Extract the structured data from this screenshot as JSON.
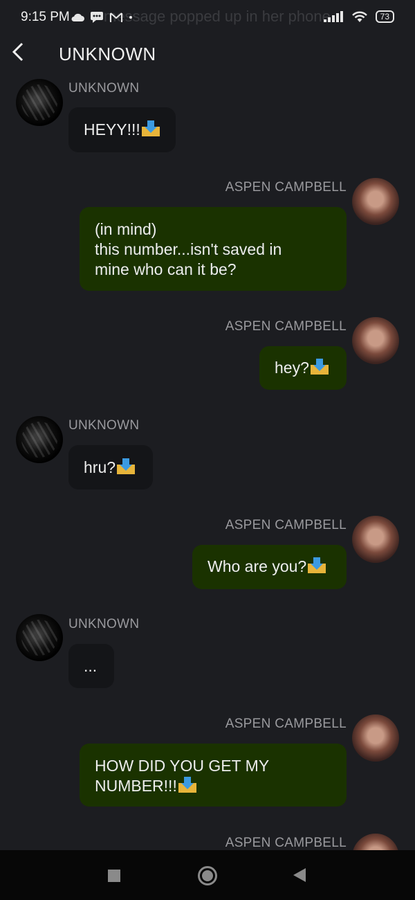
{
  "status_bar": {
    "time": "9:15 PM",
    "battery": "73",
    "ghost_notification": "message popped up in her phone"
  },
  "header": {
    "title": "UNKNOWN"
  },
  "messages": [
    {
      "sender": "UNKNOWN",
      "text": "HEYY!!!",
      "lines": []
    },
    {
      "sender": "ASPEN CAMPBELL",
      "lines": [
        "(in mind)",
        "this number...isn't saved in",
        "mine who can it be?"
      ]
    },
    {
      "sender": "ASPEN CAMPBELL",
      "text": "hey?"
    },
    {
      "sender": "UNKNOWN",
      "text": "hru?"
    },
    {
      "sender": "ASPEN CAMPBELL",
      "text": "Who are you?"
    },
    {
      "sender": "UNKNOWN",
      "text": "..."
    },
    {
      "sender": "ASPEN CAMPBELL",
      "lines": [
        "HOW DID YOU GET MY",
        "NUMBER!!!"
      ]
    },
    {
      "sender": "ASPEN CAMPBELL"
    }
  ],
  "icons": {
    "cloud": "cloud-icon",
    "message": "message-icon",
    "gmail": "gmail-icon",
    "signal": "signal-icon",
    "wifi": "wifi-icon",
    "battery": "battery-icon",
    "envelope": "incoming-envelope-emoji"
  },
  "colors": {
    "background": "#1c1d21",
    "incoming_bubble": "#141518",
    "outgoing_bubble": "#1a3200",
    "sender_text": "#9a9a9e"
  }
}
